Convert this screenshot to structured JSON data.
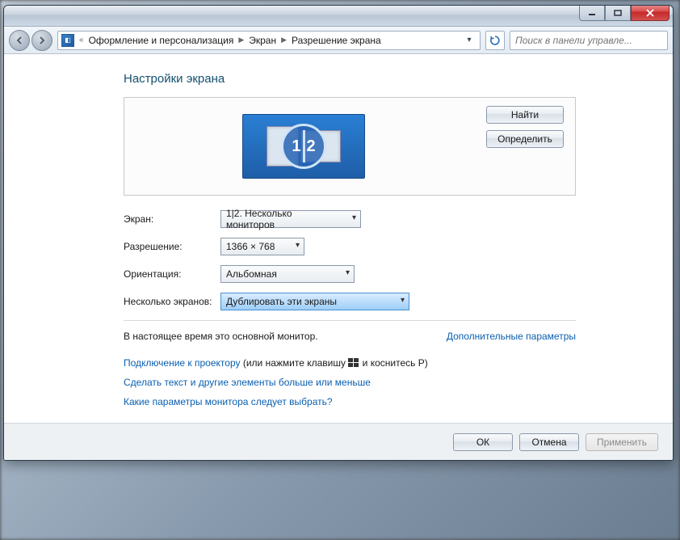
{
  "breadcrumb": {
    "prefix": "«",
    "items": [
      "Оформление и персонализация",
      "Экран",
      "Разрешение экрана"
    ]
  },
  "search": {
    "placeholder": "Поиск в панели управле..."
  },
  "heading": "Настройки экрана",
  "side_buttons": {
    "detect": "Найти",
    "identify": "Определить"
  },
  "form": {
    "display_label": "Экран:",
    "display_value": "1|2. Несколько мониторов",
    "resolution_label": "Разрешение:",
    "resolution_value": "1366 × 768",
    "orientation_label": "Ориентация:",
    "orientation_value": "Альбомная",
    "multiple_label": "Несколько экранов:",
    "multiple_value": "Дублировать эти экраны"
  },
  "info": {
    "main_monitor": "В настоящее время это основной монитор.",
    "advanced": "Дополнительные параметры"
  },
  "links": {
    "projector_a": "Подключение к проектору",
    "projector_b": " (или нажмите клавишу ",
    "projector_c": " и коснитесь P)",
    "textsize": "Сделать текст и другие элементы больше или меньше",
    "which": "Какие параметры монитора следует выбрать?"
  },
  "buttons": {
    "ok": "ОК",
    "cancel": "Отмена",
    "apply": "Применить"
  },
  "monitor_overlay": {
    "left": "1",
    "right": "2"
  }
}
